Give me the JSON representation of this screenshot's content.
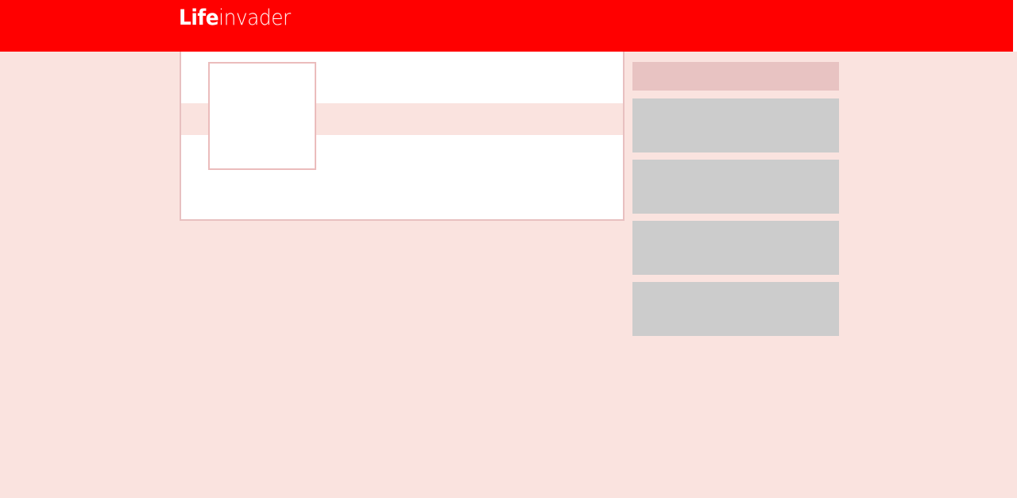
{
  "header": {
    "logo_bold": "Life",
    "logo_light": "invader"
  },
  "colors": {
    "brand_red": "#ff0000",
    "page_background": "#fae3df",
    "card_border": "#e8c0c0",
    "sidebar_header": "#e8c3c2",
    "placeholder_gray": "#cccccc"
  },
  "profile": {
    "avatar_icon": "profile-picture-placeholder"
  },
  "sidebar": {
    "block_count": 4
  }
}
